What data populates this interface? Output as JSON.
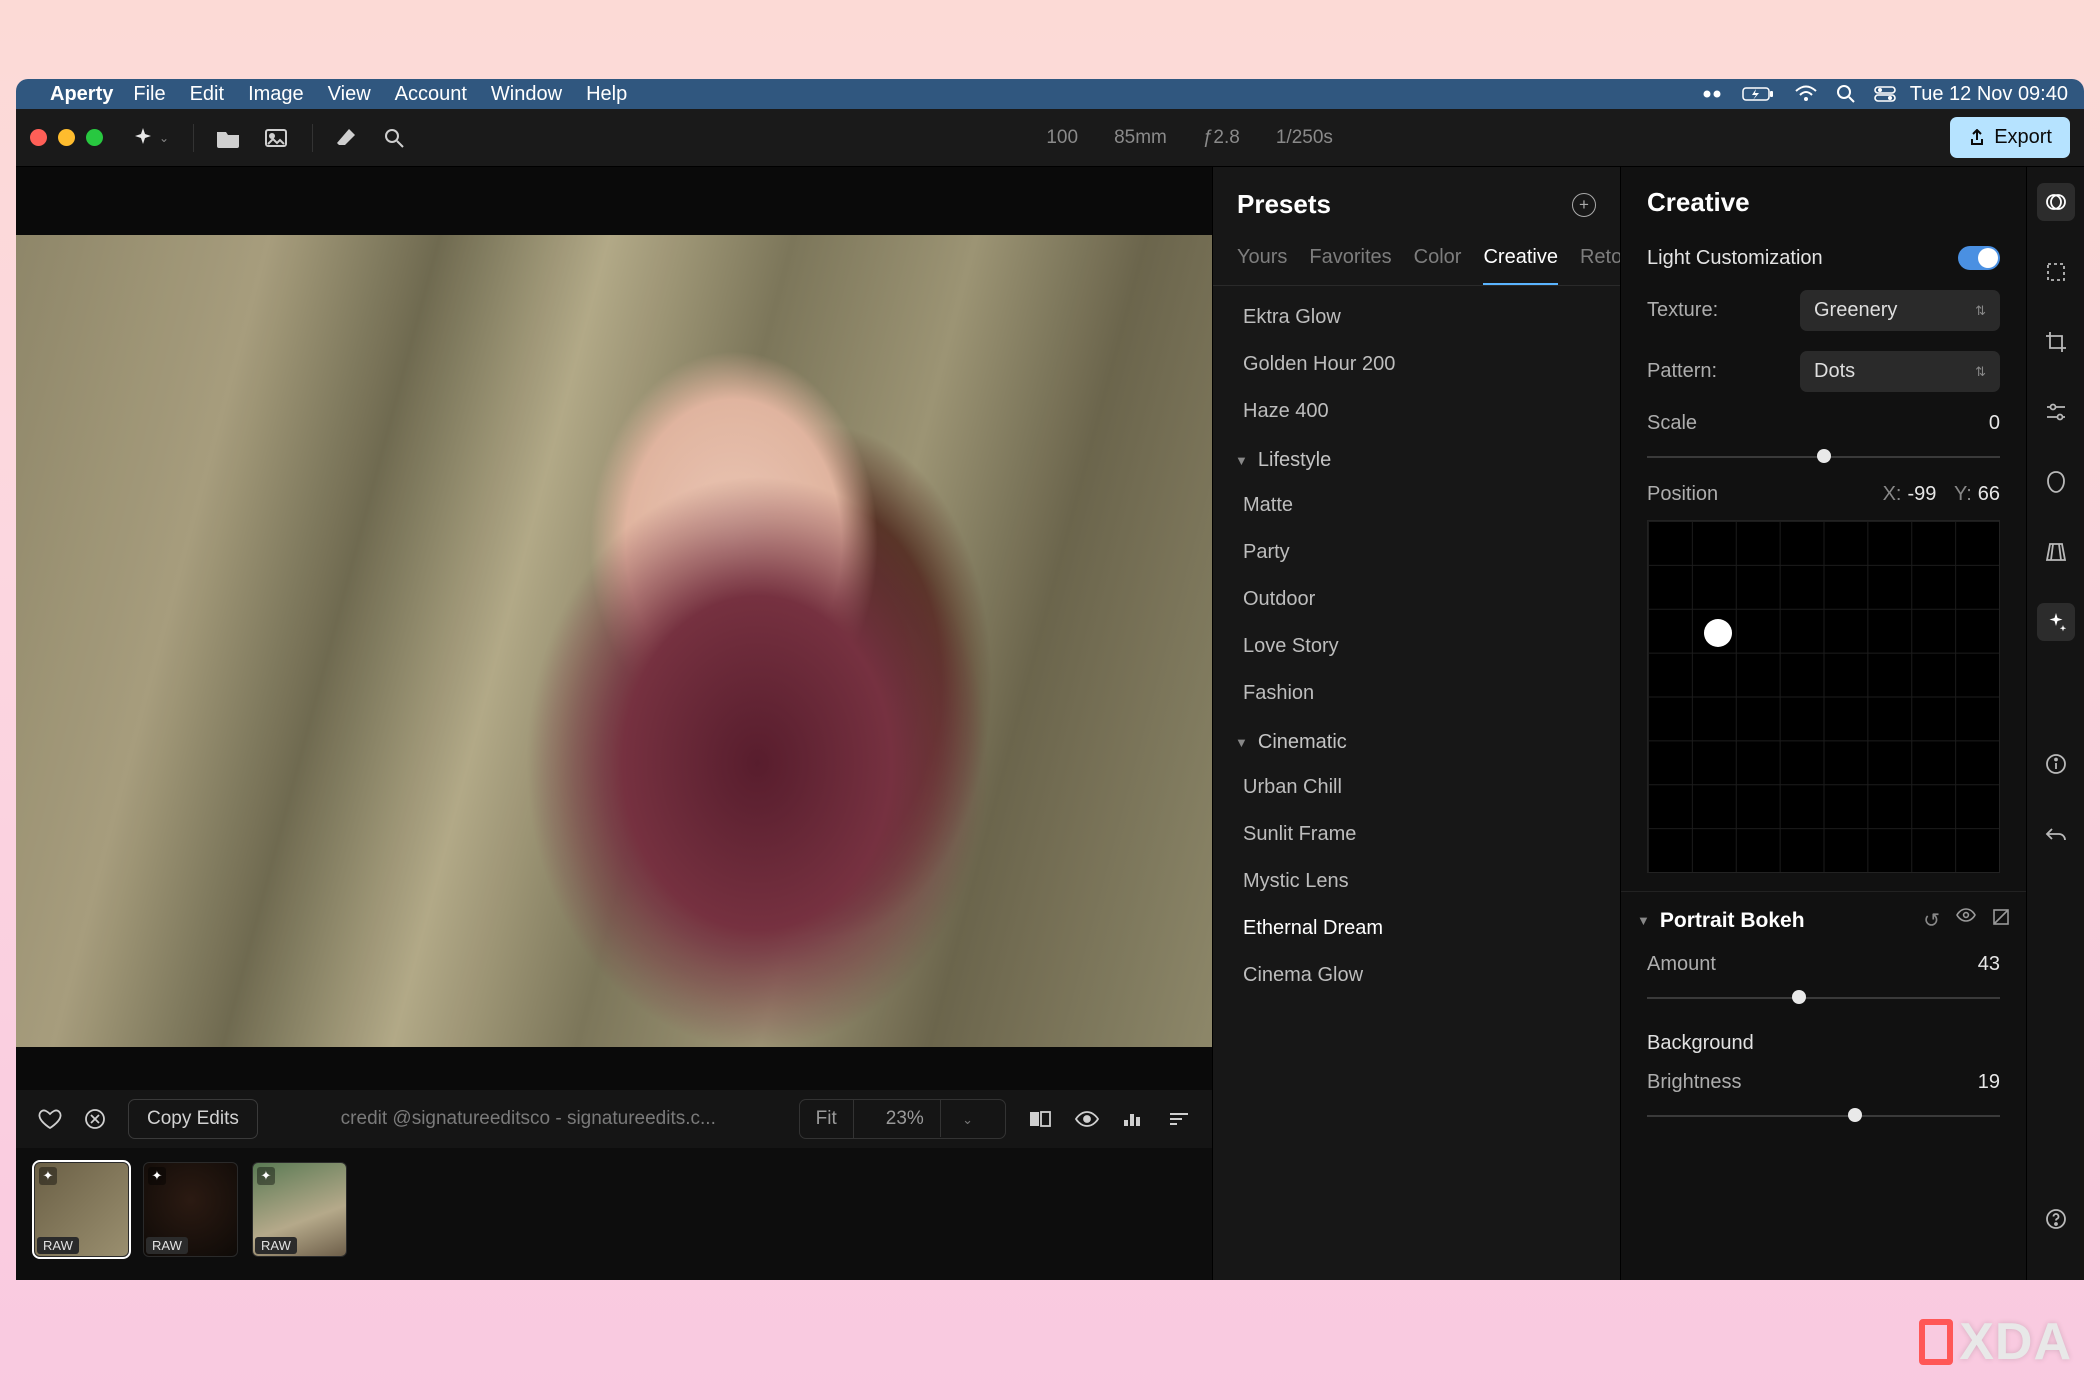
{
  "menubar": {
    "app": "Aperty",
    "items": [
      "File",
      "Edit",
      "Image",
      "View",
      "Account",
      "Window",
      "Help"
    ],
    "clock": "Tue 12 Nov  09:40"
  },
  "toolbar": {
    "meta": {
      "iso": "100",
      "focal": "85mm",
      "aperture": "ƒ2.8",
      "shutter": "1/250s"
    },
    "export_label": "Export"
  },
  "bottom": {
    "copy_label": "Copy Edits",
    "credit": "credit @signatureeditsco - signatureedits.c...",
    "fit_label": "Fit",
    "zoom": "23%"
  },
  "filmstrip": {
    "raw_label": "RAW"
  },
  "presets": {
    "title": "Presets",
    "tabs": [
      "Yours",
      "Favorites",
      "Color",
      "Creative",
      "Retou"
    ],
    "active_tab": "Creative",
    "items_top": [
      "Ektra Glow",
      "Golden Hour 200",
      "Haze 400"
    ],
    "group1": "Lifestyle",
    "items_g1": [
      "Matte",
      "Party",
      "Outdoor",
      "Love Story",
      "Fashion"
    ],
    "group2": "Cinematic",
    "items_g2": [
      "Urban Chill",
      "Sunlit Frame",
      "Mystic Lens",
      "Ethernal Dream",
      "Cinema Glow"
    ],
    "selected": "Ethernal Dream"
  },
  "creative": {
    "title": "Creative",
    "light_customization_label": "Light Customization",
    "texture_label": "Texture:",
    "texture_value": "Greenery",
    "pattern_label": "Pattern:",
    "pattern_value": "Dots",
    "scale_label": "Scale",
    "scale_value": "0",
    "position_label": "Position",
    "pos_x_label": "X:",
    "pos_x": "-99",
    "pos_y_label": "Y:",
    "pos_y": "66",
    "portrait_bokeh_label": "Portrait Bokeh",
    "amount_label": "Amount",
    "amount_value": "43",
    "background_label": "Background",
    "brightness_label": "Brightness",
    "brightness_value": "19"
  },
  "watermark": "XDA"
}
